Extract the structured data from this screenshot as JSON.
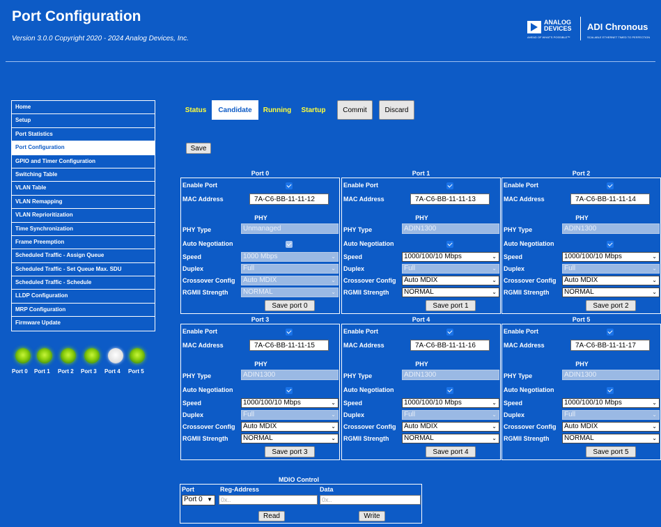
{
  "header": {
    "title": "Port Configuration",
    "version": "Version 3.0.0 Copyright 2020 - 2024 Analog Devices, Inc.",
    "logo_brand_1": "ANALOG DEVICES",
    "logo_tagline_1": "AHEAD OF WHAT'S POSSIBLE™",
    "logo_brand_2": "ADI Chronous",
    "logo_tagline_2": "SCALABLE ETHERNET TIMED TO PERFECTION"
  },
  "sidebar": {
    "items": [
      {
        "label": "Home"
      },
      {
        "label": "Setup"
      },
      {
        "label": "Port Statistics"
      },
      {
        "label": "Port Configuration",
        "active": true
      },
      {
        "label": "GPIO and Timer Configuration"
      },
      {
        "label": "Switching Table"
      },
      {
        "label": "VLAN Table"
      },
      {
        "label": "VLAN Remapping"
      },
      {
        "label": "VLAN Reprioritization"
      },
      {
        "label": "Time Synchronization"
      },
      {
        "label": "Frame Preemption"
      },
      {
        "label": "Scheduled Traffic - Assign Queue"
      },
      {
        "label": "Scheduled Traffic - Set Queue Max. SDU"
      },
      {
        "label": "Scheduled Traffic - Schedule"
      },
      {
        "label": "LLDP Configuration"
      },
      {
        "label": "MRP Configuration"
      },
      {
        "label": "Firmware Update"
      }
    ]
  },
  "leds": [
    {
      "label": "Port 0",
      "state": "green"
    },
    {
      "label": "Port 1",
      "state": "green"
    },
    {
      "label": "Port 2",
      "state": "green"
    },
    {
      "label": "Port 3",
      "state": "green"
    },
    {
      "label": "Port 4",
      "state": "off"
    },
    {
      "label": "Port 5",
      "state": "green"
    }
  ],
  "tabs": {
    "status": "Status",
    "candidate": "Candidate",
    "running": "Running",
    "startup": "Startup",
    "commit": "Commit",
    "discard": "Discard"
  },
  "save_label": "Save",
  "labels": {
    "enable_port": "Enable Port",
    "mac_address": "MAC Address",
    "phy": "PHY",
    "phy_type": "PHY Type",
    "auto_negotiation": "Auto Negotiation",
    "speed": "Speed",
    "duplex": "Duplex",
    "crossover": "Crossover Config",
    "rgmii": "RGMII Strength"
  },
  "ports": [
    {
      "title": "Port 0",
      "mac": "7A-C6-BB-11-11-12",
      "phy_type": "Unmanaged",
      "speed": "1000 Mbps",
      "duplex": "Full",
      "crossover": "Auto MDIX",
      "rgmii": "NORMAL",
      "save": "Save port 0",
      "editable": false
    },
    {
      "title": "Port 1",
      "mac": "7A-C6-BB-11-11-13",
      "phy_type": "ADIN1300",
      "speed": "1000/100/10 Mbps",
      "duplex": "Full",
      "crossover": "Auto MDIX",
      "rgmii": "NORMAL",
      "save": "Save port 1",
      "editable": true
    },
    {
      "title": "Port 2",
      "mac": "7A-C6-BB-11-11-14",
      "phy_type": "ADIN1300",
      "speed": "1000/100/10 Mbps",
      "duplex": "Full",
      "crossover": "Auto MDIX",
      "rgmii": "NORMAL",
      "save": "Save port 2",
      "editable": true
    },
    {
      "title": "Port 3",
      "mac": "7A-C6-BB-11-11-15",
      "phy_type": "ADIN1300",
      "speed": "1000/100/10 Mbps",
      "duplex": "Full",
      "crossover": "Auto MDIX",
      "rgmii": "NORMAL",
      "save": "Save port 3",
      "editable": true
    },
    {
      "title": "Port 4",
      "mac": "7A-C6-BB-11-11-16",
      "phy_type": "ADIN1300",
      "speed": "1000/100/10 Mbps",
      "duplex": "Full",
      "crossover": "Auto MDIX",
      "rgmii": "NORMAL",
      "save": "Save port 4",
      "editable": true
    },
    {
      "title": "Port 5",
      "mac": "7A-C6-BB-11-11-17",
      "phy_type": "ADIN1300",
      "speed": "1000/100/10 Mbps",
      "duplex": "Full",
      "crossover": "Auto MDIX",
      "rgmii": "NORMAL",
      "save": "Save port 5",
      "editable": true
    }
  ],
  "mdio": {
    "title": "MDIO Control",
    "port_header": "Port",
    "reg_header": "Reg-Address",
    "data_header": "Data",
    "port_value": "Port 0",
    "reg_placeholder": "0x..",
    "data_placeholder": "0x..",
    "read": "Read",
    "write": "Write"
  },
  "colors": {
    "background": "#0d5bc6",
    "tab_text": "#ffff3a",
    "led_on": "#8fd10e"
  }
}
